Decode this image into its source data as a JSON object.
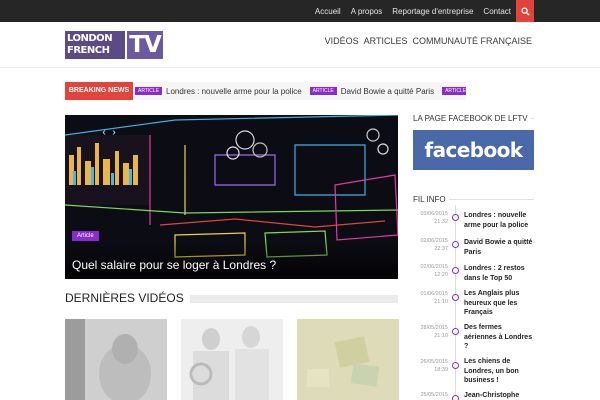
{
  "topbar": {
    "links": [
      "Accueil",
      "A propos",
      "Reportage d'entreprise",
      "Contact"
    ],
    "search_icon": "search-icon"
  },
  "header": {
    "logo": {
      "line1": "LONDON",
      "line2": "FRENCH",
      "tv": "TV"
    },
    "nav": [
      "VIDÉOS",
      "ARTICLES",
      "COMMUNAUTÉ FRANÇAISE"
    ]
  },
  "breaking": {
    "label": "BREAKING NEWS",
    "items": [
      {
        "tag": "ARTICLE",
        "text": "Londres : nouvelle arme pour la police"
      },
      {
        "tag": "ARTICLE",
        "text": "David Bowie a quitté Paris"
      },
      {
        "tag": "ARTICLE",
        "text": "Lo"
      }
    ]
  },
  "hero": {
    "tag": "Article",
    "title": "Quel salaire pour se loger à Londres ?",
    "prev_icon": "chevron-left-icon",
    "next_icon": "chevron-right-icon"
  },
  "sidebar": {
    "facebook_title": "LA PAGE FACEBOOK DE LFTV",
    "facebook_label": "facebook",
    "fil_title": "FIL INFO",
    "fil_items": [
      {
        "date": "03/06/2015",
        "time": "21:32",
        "text": "Londres : nouvelle arme pour la police"
      },
      {
        "date": "02/06/2015",
        "time": "22:37",
        "text": "David Bowie a quitté Paris"
      },
      {
        "date": "02/06/2015",
        "time": "12:20",
        "text": "Londres : 2 restos dans le Top 50"
      },
      {
        "date": "01/06/2015",
        "time": "21:10",
        "text": "Les Anglais plus heureux que les Français"
      },
      {
        "date": "28/05/2015",
        "time": "21:10",
        "text": "Des fermes aériennes à Londres ?"
      },
      {
        "date": "26/05/2015",
        "time": "18:39",
        "text": "Les chiens de Londres, un bon business !"
      },
      {
        "date": "25/05/2015",
        "time": "",
        "text": "Jean-Christophe"
      }
    ]
  },
  "videos": {
    "title": "DERNIÈRES VIDÉOS"
  },
  "colors": {
    "accent": "#8a2bd0",
    "breaking": "#e0443a",
    "topbar": "#262626",
    "facebook": "#4a69a8",
    "logo": "#5a4a86"
  }
}
